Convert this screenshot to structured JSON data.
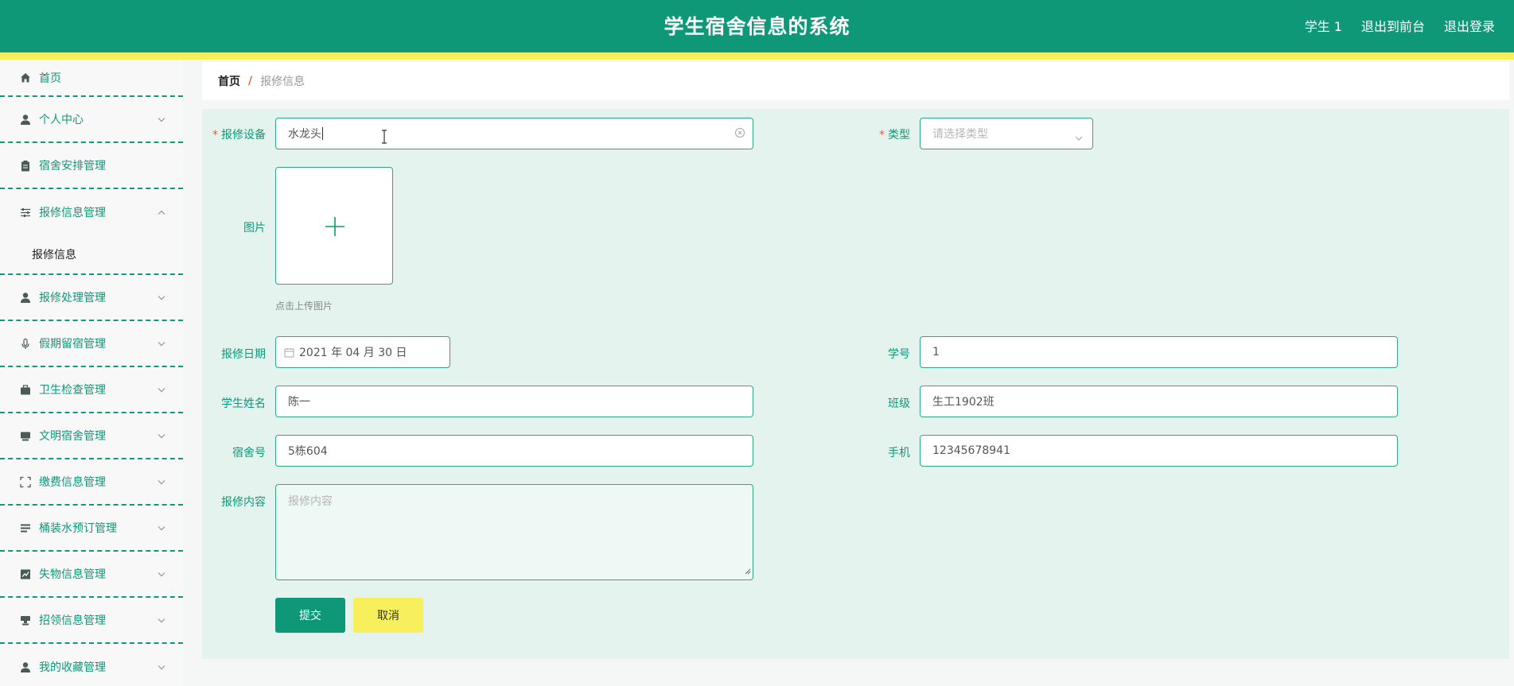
{
  "header": {
    "title": "学生宿舍信息的系统",
    "user": "学生 1",
    "to_front": "退出到前台",
    "logout": "退出登录"
  },
  "sidebar": {
    "items": [
      {
        "label": "首页",
        "icon": "home-icon"
      },
      {
        "label": "个人中心",
        "icon": "user-icon"
      },
      {
        "label": "宿舍安排管理",
        "icon": "clipboard-icon"
      },
      {
        "label": "报修信息管理",
        "icon": "sliders-icon",
        "expanded": true,
        "sub": "报修信息"
      },
      {
        "label": "报修处理管理",
        "icon": "user-icon"
      },
      {
        "label": "假期留宿管理",
        "icon": "mic-icon"
      },
      {
        "label": "卫生检查管理",
        "icon": "briefcase-icon"
      },
      {
        "label": "文明宿舍管理",
        "icon": "monitor-icon"
      },
      {
        "label": "缴费信息管理",
        "icon": "fullscreen-icon"
      },
      {
        "label": "桶装水预订管理",
        "icon": "list-icon"
      },
      {
        "label": "失物信息管理",
        "icon": "chart-icon"
      },
      {
        "label": "招领信息管理",
        "icon": "stamp-icon"
      },
      {
        "label": "我的收藏管理",
        "icon": "user-icon"
      }
    ]
  },
  "breadcrumb": {
    "home": "首页",
    "separator": "/",
    "current": "报修信息"
  },
  "form": {
    "device_label": "报修设备",
    "device_value": "水龙头",
    "type_label": "类型",
    "type_placeholder": "请选择类型",
    "image_label": "图片",
    "upload_hint": "点击上传图片",
    "date_label": "报修日期",
    "date_value": "2021 年 04 月 30 日",
    "student_no_label": "学号",
    "student_no_value": "1",
    "name_label": "学生姓名",
    "name_value": "陈一",
    "class_label": "班级",
    "class_value": "生工1902班",
    "dorm_label": "宿舍号",
    "dorm_value": "5栋604",
    "phone_label": "手机",
    "phone_value": "12345678941",
    "content_label": "报修内容",
    "content_placeholder": "报修内容",
    "submit": "提交",
    "cancel": "取消"
  },
  "colors": {
    "primary": "#0f9878",
    "accent_yellow": "#f7f05c",
    "panel_bg": "#e4f3ee",
    "required": "#f05a3c"
  }
}
